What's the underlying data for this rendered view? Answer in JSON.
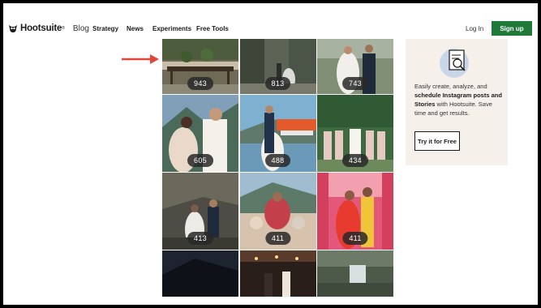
{
  "nav": {
    "brand": "Hootsuite",
    "brand_mark": "®",
    "section": "Blog",
    "links": [
      "Strategy",
      "News",
      "Experiments",
      "Free Tools"
    ],
    "login": "Log In",
    "signup": "Sign up"
  },
  "grid": {
    "counts": [
      "943",
      "813",
      "743",
      "605",
      "488",
      "434",
      "413",
      "411",
      "411"
    ]
  },
  "promo": {
    "text_a": "Easily create, analyze, and ",
    "text_bold": "schedule Instagram posts and Stories",
    "text_b": " with Hootsuite. Save time and get results.",
    "button": "Try it for Free"
  },
  "colors": {
    "signup_bg": "#1f7a3a",
    "arrow": "#e2463a",
    "promo_bg": "#f5f0ea"
  }
}
